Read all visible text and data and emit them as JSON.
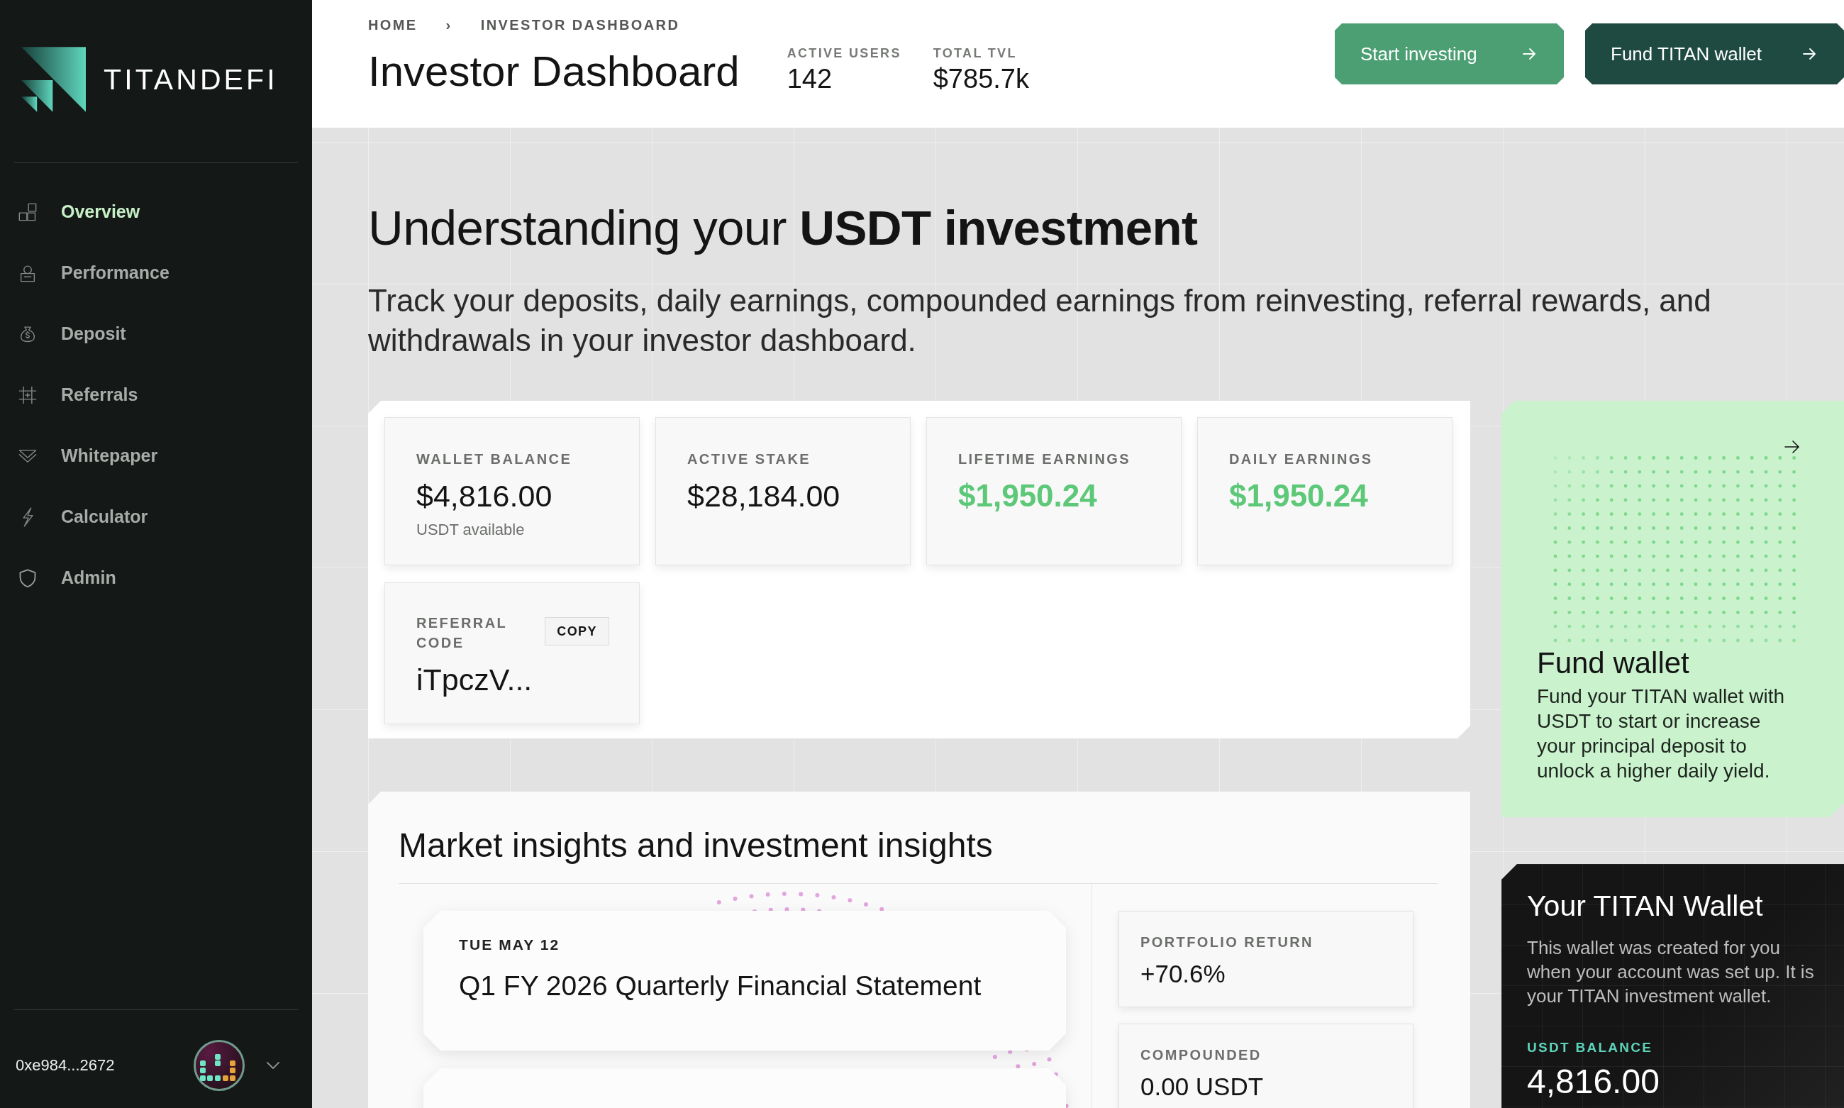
{
  "sidebar": {
    "logo": "TITANDEFI",
    "items": [
      {
        "label": "Overview",
        "selected": true
      },
      {
        "label": "Performance",
        "selected": false
      },
      {
        "label": "Deposit",
        "selected": false
      },
      {
        "label": "Referrals",
        "selected": false
      },
      {
        "label": "Whitepaper",
        "selected": false
      },
      {
        "label": "Calculator",
        "selected": false
      },
      {
        "label": "Admin",
        "selected": false
      }
    ],
    "account": {
      "address": "0xe984...2672"
    }
  },
  "header": {
    "breadcrumb": [
      "HOME",
      "INVESTOR DASHBOARD"
    ],
    "separator": "›",
    "title": "Investor Dashboard",
    "stats": [
      {
        "label": "ACTIVE USERS",
        "value": "142"
      },
      {
        "label": "TOTAL TVL",
        "value": "$785.7k"
      }
    ],
    "buttons": [
      {
        "label": "Start investing",
        "kind": "primary"
      },
      {
        "label": "Fund TITAN wallet",
        "kind": "dark"
      }
    ]
  },
  "hero": {
    "heading": "Understanding your **USDT investment**",
    "text": "Track your deposits, daily earnings, compounded earnings from reinvesting, referral rewards, and withdrawals in your investor dashboard."
  },
  "summary_cards": [
    {
      "label": "WALLET BALANCE",
      "value": "$4,816.00",
      "note": "USDT available",
      "highlight": false
    },
    {
      "label": "ACTIVE STAKE",
      "value": "$28,184.00",
      "highlight": false
    },
    {
      "label": "LIFETIME EARNINGS",
      "value": "$1,950.24",
      "highlight": true
    },
    {
      "label": "DAILY EARNINGS",
      "value": "$1,950.24",
      "highlight": true
    }
  ],
  "referral": {
    "label": "REFERRAL CODE",
    "button": "COPY",
    "code": "iTpczV..."
  },
  "insights": {
    "title": "Market insights and investment insights",
    "events": [
      {
        "date": "TUE MAY 12",
        "title": "Q1 FY 2026 Quarterly Financial Statement"
      }
    ],
    "more_events": true,
    "stats": [
      {
        "label": "PORTFOLIO RETURN",
        "value": "+70.6%"
      },
      {
        "label": "COMPOUNDED",
        "value": "0.00 USDT"
      }
    ]
  },
  "fund_card": {
    "title": "Fund wallet",
    "text": "Fund your TITAN wallet with USDT to start or increase your principal deposit to unlock a higher daily yield."
  },
  "wallet_card": {
    "title": "Your TITAN Wallet",
    "text": "This wallet was created for you when your account was set up. It is your TITAN investment wallet.",
    "balance_label": "USDT BALANCE",
    "balance": "4,816.00"
  }
}
